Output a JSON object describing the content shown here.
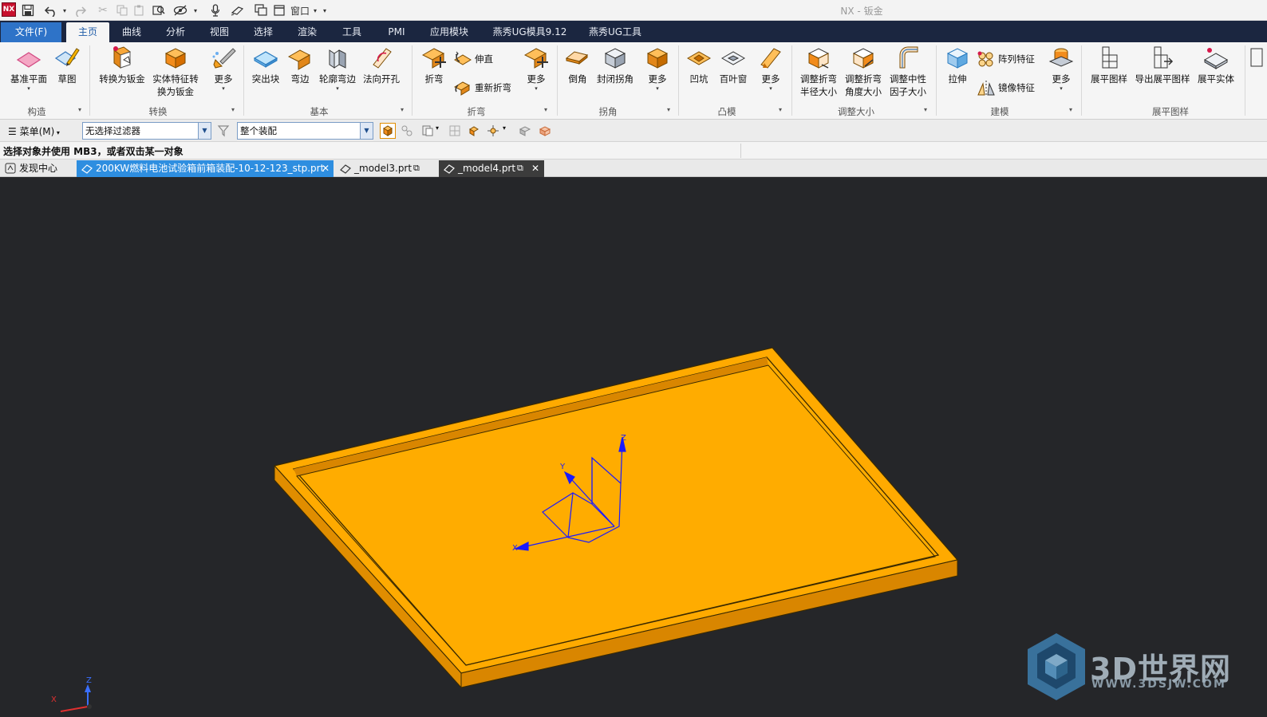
{
  "app": {
    "title": "NX - 钣金",
    "logo_text": "NX"
  },
  "quick_access": {
    "window_label": "窗口"
  },
  "ribbon_tabs": {
    "file": "文件(F)",
    "tabs": [
      "主页",
      "曲线",
      "分析",
      "视图",
      "选择",
      "渲染",
      "工具",
      "PMI",
      "应用模块",
      "燕秀UG模具9.12",
      "燕秀UG工具"
    ],
    "active": "主页"
  },
  "ribbon": {
    "construct": {
      "label": "构造",
      "datum_plane": "基准平面",
      "sketch": "草图"
    },
    "convert": {
      "label": "转换",
      "convert_to_sheet": "转换为钣金",
      "solid_feature_line1": "实体特征转",
      "solid_feature_line2": "换为钣金",
      "more": "更多"
    },
    "basic": {
      "label": "基本",
      "tab": "突出块",
      "flange": "弯边",
      "contour_flange": "轮廓弯边",
      "normal_cutout": "法向开孔"
    },
    "bend": {
      "label": "折弯",
      "bend": "折弯",
      "unbend": "伸直",
      "rebend": "重新折弯",
      "more": "更多"
    },
    "corner": {
      "label": "拐角",
      "chamfer": "倒角",
      "closed_corner": "封闭拐角",
      "more": "更多"
    },
    "emboss": {
      "label": "凸模",
      "dimple": "凹坑",
      "louver": "百叶窗",
      "more": "更多"
    },
    "resize": {
      "label": "调整大小",
      "radius_line1": "调整折弯",
      "radius_line2": "半径大小",
      "angle_line1": "调整折弯",
      "angle_line2": "角度大小",
      "neutral_line1": "调整中性",
      "neutral_line2": "因子大小"
    },
    "modeling": {
      "label": "建模",
      "extrude": "拉伸",
      "pattern": "阵列特征",
      "mirror": "镜像特征",
      "more": "更多"
    },
    "flat_pattern": {
      "label": "展平图样",
      "flat_pattern": "展平图样",
      "export_flat": "导出展平图样",
      "flat_solid": "展平实体"
    }
  },
  "selection_bar": {
    "menu": "菜单(M)",
    "type_filter": "无选择过滤器",
    "scope": "整个装配"
  },
  "cue_line": {
    "text": "选择对象并使用 MB3，或者双击某一对象"
  },
  "doc_tabs": [
    {
      "label": "发现中心"
    },
    {
      "label": "200KW燃料电池试验箱前箱装配-10-12-123_stp.prt"
    },
    {
      "label": "_model3.prt"
    },
    {
      "label": "_model4.prt"
    }
  ],
  "viewport": {
    "background": "#252629",
    "part_color": "#ffa900",
    "part_side_color": "#e08d00",
    "csys_labels": {
      "x": "X",
      "y": "Y",
      "z": "Z"
    },
    "watermark": {
      "name": "3D世界网",
      "url": "WWW.3DSJW.COM"
    }
  }
}
